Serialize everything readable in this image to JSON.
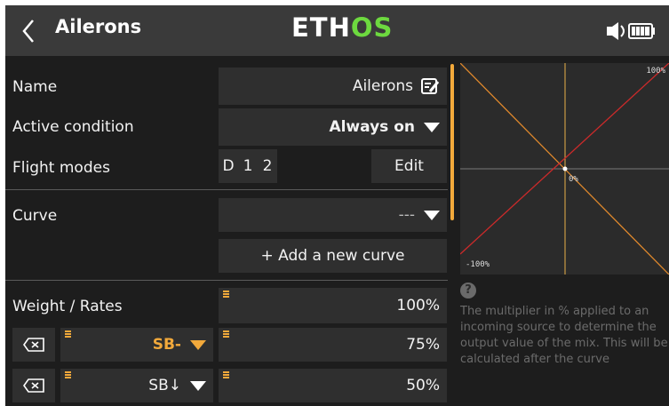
{
  "header": {
    "title": "Ailerons",
    "logo_main": "ETH",
    "logo_accent": "OS"
  },
  "form": {
    "name": {
      "label": "Name",
      "value": "Ailerons"
    },
    "active_condition": {
      "label": "Active condition",
      "value": "Always on"
    },
    "flight_modes": {
      "label": "Flight modes",
      "modes": [
        "D",
        "1",
        "2"
      ],
      "edit_label": "Edit"
    },
    "curve": {
      "label": "Curve",
      "value": "---",
      "add_label": "+ Add a new curve"
    },
    "weight": {
      "label": "Weight / Rates",
      "value": "100%",
      "rates": [
        {
          "source": "SB-",
          "value": "75%"
        },
        {
          "source": "SB↓",
          "value": "50%"
        }
      ]
    }
  },
  "graph": {
    "top_right_label": "100%",
    "center_label": "0%",
    "bottom_left_label": "-100%"
  },
  "help": {
    "icon": "?",
    "text": "The multiplier in % applied to an incoming source to determine the output value of the mix. This will be calculated after the curve"
  },
  "colors": {
    "accent": "#f2a93b",
    "logo_green": "#6dd93f",
    "curve_red": "#cc2a2a",
    "curve_orange": "#e0892c"
  }
}
